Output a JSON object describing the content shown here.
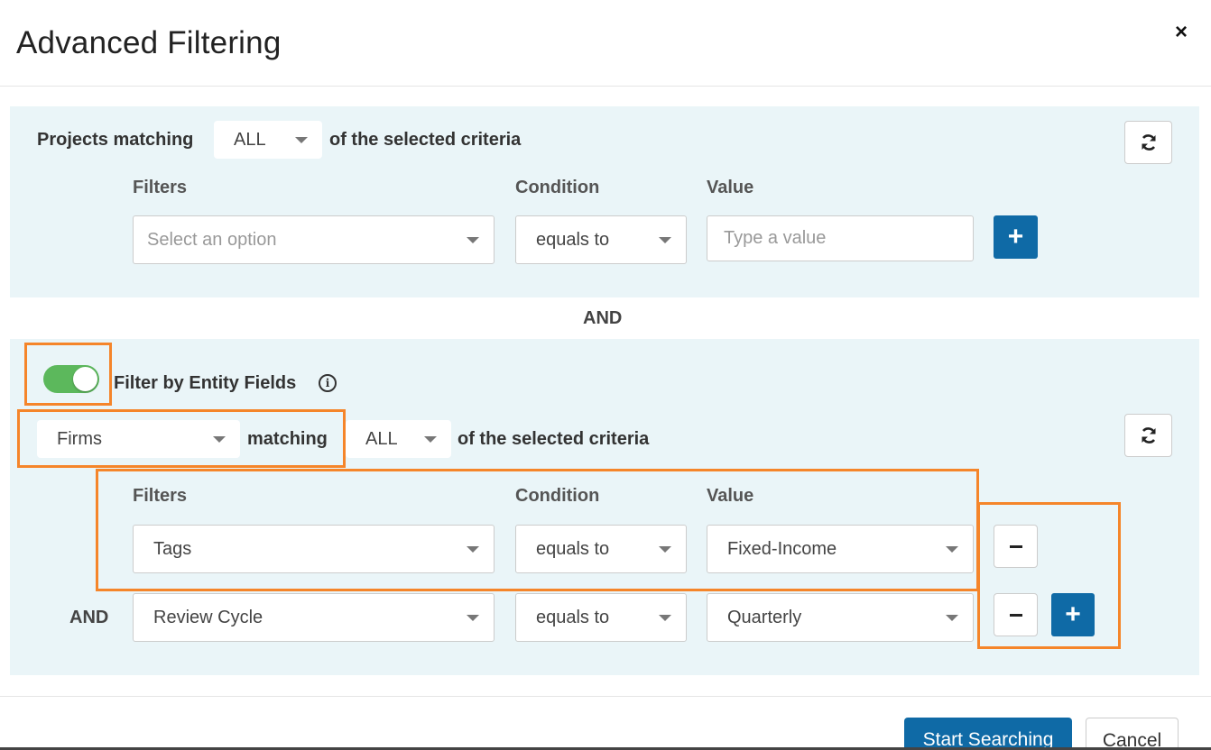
{
  "modal": {
    "title": "Advanced Filtering",
    "close_symbol": "×"
  },
  "projects_section": {
    "prefix_label": "Projects matching",
    "match_mode": "ALL",
    "suffix_label": "of the selected criteria",
    "refresh_icon": "refresh-icon",
    "column_headers": {
      "filters": "Filters",
      "condition": "Condition",
      "value": "Value"
    },
    "row": {
      "filter_placeholder": "Select an option",
      "condition": "equals to",
      "value_placeholder": "Type a value",
      "add_symbol": "+"
    }
  },
  "joiner_label": "AND",
  "entity_section": {
    "toggle_on": true,
    "toggle_label": "Filter by Entity Fields",
    "info_symbol": "i",
    "entity_type": "Firms",
    "matching_label": "matching",
    "match_mode": "ALL",
    "suffix_label": "of the selected criteria",
    "refresh_icon": "refresh-icon",
    "column_headers": {
      "filters": "Filters",
      "condition": "Condition",
      "value": "Value"
    },
    "rows": [
      {
        "joiner": "",
        "filter": "Tags",
        "condition": "equals to",
        "value": "Fixed-Income"
      },
      {
        "joiner": "AND",
        "filter": "Review Cycle",
        "condition": "equals to",
        "value": "Quarterly"
      }
    ],
    "add_symbol": "+"
  },
  "footer": {
    "start_label": "Start Searching",
    "cancel_label": "Cancel"
  },
  "colors": {
    "accent": "#0f6aa6",
    "panel_bg": "#eaf5f8",
    "toggle_on": "#5cb85c",
    "highlight": "#f5852a"
  }
}
